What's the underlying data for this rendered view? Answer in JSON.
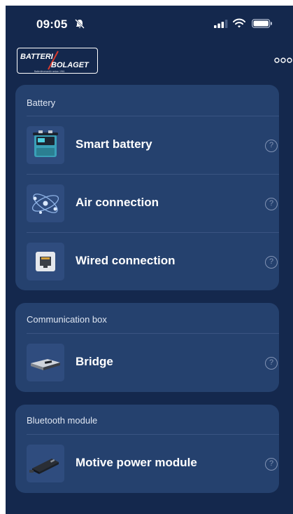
{
  "status_bar": {
    "time": "09:05",
    "icons": [
      "bell-slash-icon",
      "signal-icon",
      "wifi-icon",
      "battery-icon"
    ]
  },
  "header": {
    "logo": {
      "line1": "BATTERI",
      "line2": "BOLAGET",
      "tagline": "Batterileverantör sedan 1961"
    },
    "more_icon": "more-dots-icon"
  },
  "sections": [
    {
      "title": "Battery",
      "items": [
        {
          "label": "Smart battery",
          "icon": "smart-battery-image",
          "help": "?"
        },
        {
          "label": "Air connection",
          "icon": "air-connection-image",
          "help": "?"
        },
        {
          "label": "Wired connection",
          "icon": "wired-connection-image",
          "help": "?"
        }
      ]
    },
    {
      "title": "Communication box",
      "items": [
        {
          "label": "Bridge",
          "icon": "bridge-image",
          "help": "?"
        }
      ]
    },
    {
      "title": "Bluetooth module",
      "items": [
        {
          "label": "Motive power module",
          "icon": "motive-power-module-image",
          "help": "?"
        }
      ]
    }
  ],
  "colors": {
    "background": "#14284d",
    "card": "#25416e",
    "thumb": "#2f4c7e",
    "text": "#ffffff",
    "muted": "#8293b4"
  }
}
